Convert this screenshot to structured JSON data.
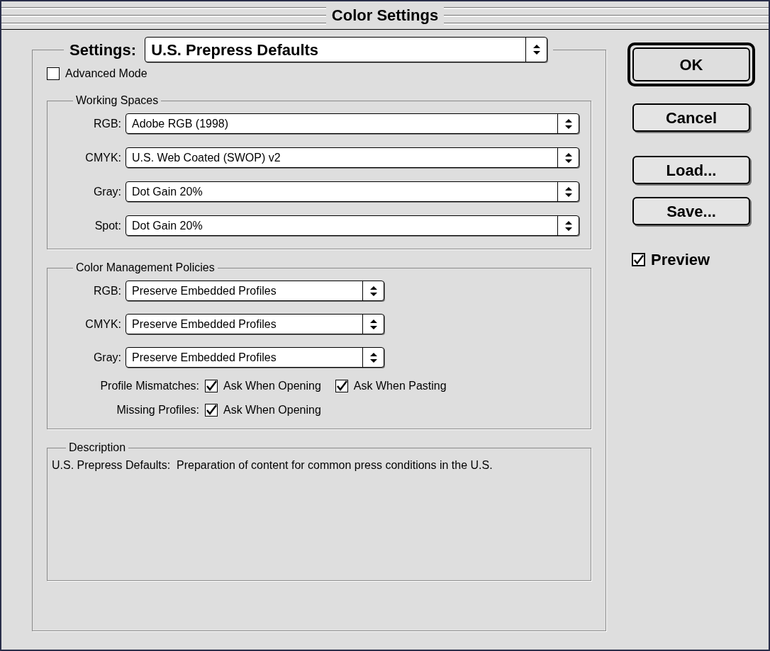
{
  "window": {
    "title": "Color Settings"
  },
  "settings": {
    "label": "Settings:",
    "value": "U.S. Prepress Defaults"
  },
  "advanced_mode": {
    "label": "Advanced Mode",
    "checked": false
  },
  "working_spaces": {
    "title": "Working Spaces",
    "rows": [
      {
        "label": "RGB:",
        "value": "Adobe RGB (1998)"
      },
      {
        "label": "CMYK:",
        "value": "U.S. Web Coated (SWOP) v2"
      },
      {
        "label": "Gray:",
        "value": "Dot Gain 20%"
      },
      {
        "label": "Spot:",
        "value": "Dot Gain 20%"
      }
    ]
  },
  "policies": {
    "title": "Color Management Policies",
    "rows": [
      {
        "label": "RGB:",
        "value": "Preserve Embedded Profiles"
      },
      {
        "label": "CMYK:",
        "value": "Preserve Embedded Profiles"
      },
      {
        "label": "Gray:",
        "value": "Preserve Embedded Profiles"
      }
    ],
    "checks": [
      {
        "label": "Profile Mismatches:",
        "options": [
          {
            "label": "Ask When Opening",
            "checked": true
          },
          {
            "label": "Ask When Pasting",
            "checked": true
          }
        ]
      },
      {
        "label": "Missing Profiles:",
        "options": [
          {
            "label": "Ask When Opening",
            "checked": true
          }
        ]
      }
    ]
  },
  "description": {
    "title": "Description",
    "text": "U.S. Prepress Defaults:  Preparation of content for common press conditions in the U.S."
  },
  "buttons": [
    {
      "label": "OK",
      "default": true
    },
    {
      "label": "Cancel",
      "default": false
    },
    {
      "label": "Load...",
      "default": false
    },
    {
      "label": "Save...",
      "default": false
    }
  ],
  "preview": {
    "label": "Preview",
    "checked": true
  }
}
